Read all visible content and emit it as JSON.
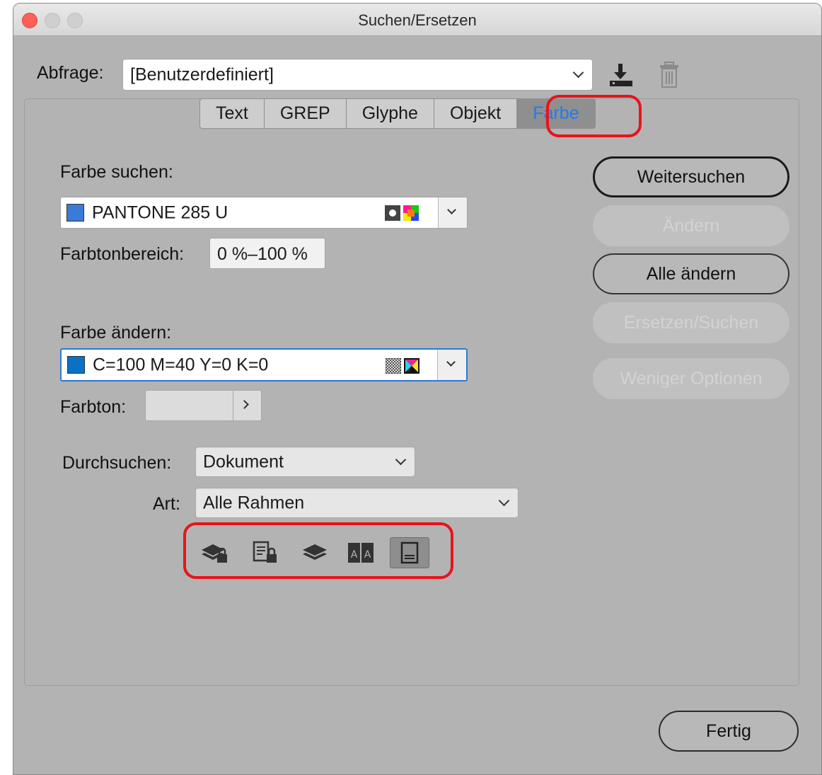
{
  "window": {
    "title": "Suchen/Ersetzen"
  },
  "query": {
    "label": "Abfrage:",
    "value": "[Benutzerdefiniert]"
  },
  "tabs": [
    {
      "label": "Text",
      "active": false
    },
    {
      "label": "GREP",
      "active": false
    },
    {
      "label": "Glyphe",
      "active": false
    },
    {
      "label": "Objekt",
      "active": false
    },
    {
      "label": "Farbe",
      "active": true
    }
  ],
  "find_color": {
    "label": "Farbe suchen:",
    "value": "PANTONE 285 U",
    "swatch_color": "#3a7bd5",
    "tint_range_label": "Farbtonbereich:",
    "tint_range_value": "0 %–100 %"
  },
  "change_color": {
    "label": "Farbe ändern:",
    "value": "C=100 M=40 Y=0 K=0",
    "swatch_color": "#0a72c4",
    "tint_label": "Farbton:",
    "tint_value": ""
  },
  "search": {
    "label": "Durchsuchen:",
    "value": "Dokument",
    "type_label": "Art:",
    "type_value": "Alle Rahmen"
  },
  "toolbar_icons": [
    "locked-layers-icon",
    "locked-stories-icon",
    "hidden-layers-icon",
    "master-pages-icon",
    "footnotes-icon"
  ],
  "buttons": {
    "find_next": "Weitersuchen",
    "change": "Ändern",
    "change_all": "Alle ändern",
    "change_find": "Ersetzen/Suchen",
    "fewer_options": "Weniger Optionen",
    "done": "Fertig"
  },
  "colors": {
    "highlight": "#e8131a",
    "active_tab_text": "#1f7cf0",
    "focus": "#2f78d2"
  }
}
